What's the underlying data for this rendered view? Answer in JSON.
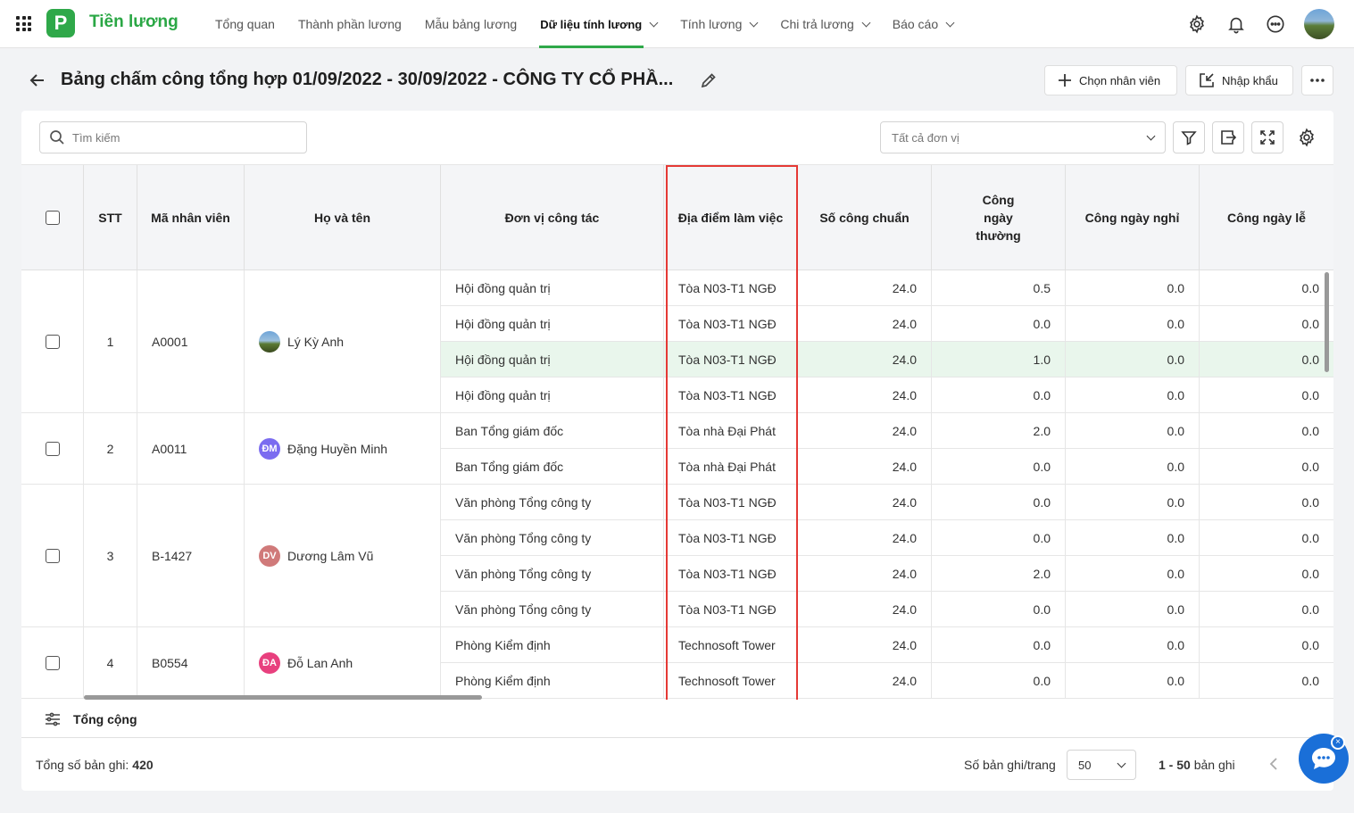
{
  "app": {
    "logo_letter": "P",
    "title": "Tiền lương",
    "accent": "#2fa849"
  },
  "nav": [
    {
      "label": "Tổng quan",
      "dropdown": false,
      "active": false
    },
    {
      "label": "Thành phần lương",
      "dropdown": false,
      "active": false
    },
    {
      "label": "Mẫu bảng lương",
      "dropdown": false,
      "active": false
    },
    {
      "label": "Dữ liệu tính lương",
      "dropdown": true,
      "active": true
    },
    {
      "label": "Tính lương",
      "dropdown": true,
      "active": false
    },
    {
      "label": "Chi trả lương",
      "dropdown": true,
      "active": false
    },
    {
      "label": "Báo cáo",
      "dropdown": true,
      "active": false
    }
  ],
  "page": {
    "title": "Bảng chấm công tổng hợp 01/09/2022 - 30/09/2022 - CÔNG TY CỔ PHẦ...",
    "choose_employee": "Chọn nhân viên",
    "import": "Nhập khẩu"
  },
  "toolbar": {
    "search_placeholder": "Tìm kiếm",
    "unit_filter": "Tất cả đơn vị"
  },
  "columns": {
    "stt": "STT",
    "code": "Mã nhân viên",
    "name": "Họ và tên",
    "unit": "Đơn vị công tác",
    "location": "Địa điểm làm việc",
    "standard": "Số công chuẩn",
    "normal_day": "Công ngày thường",
    "day_off": "Công ngày nghỉ",
    "holiday": "Công ngày lễ"
  },
  "employees": [
    {
      "stt": "1",
      "code": "A0001",
      "name": "Lý Kỳ Anh",
      "initials": "",
      "avatar_color": "photo",
      "rows": [
        {
          "unit": "Hội đồng quản trị",
          "location": "Tòa N03-T1 NGĐ",
          "standard": "24.0",
          "normal": "0.5",
          "off": "0.0",
          "holiday": "0.0"
        },
        {
          "unit": "Hội đồng quản trị",
          "location": "Tòa N03-T1 NGĐ",
          "standard": "24.0",
          "normal": "0.0",
          "off": "0.0",
          "holiday": "0.0"
        },
        {
          "unit": "Hội đồng quản trị",
          "location": "Tòa N03-T1 NGĐ",
          "standard": "24.0",
          "normal": "1.0",
          "off": "0.0",
          "holiday": "0.0"
        },
        {
          "unit": "Hội đồng quản trị",
          "location": "Tòa N03-T1 NGĐ",
          "standard": "24.0",
          "normal": "0.0",
          "off": "0.0",
          "holiday": "0.0"
        }
      ]
    },
    {
      "stt": "2",
      "code": "A0011",
      "name": "Đặng Huyền Minh",
      "initials": "ĐM",
      "avatar_color": "#7b6cf0",
      "rows": [
        {
          "unit": "Ban Tổng giám đốc",
          "location": "Tòa nhà Đại Phát",
          "standard": "24.0",
          "normal": "2.0",
          "off": "0.0",
          "holiday": "0.0"
        },
        {
          "unit": "Ban Tổng giám đốc",
          "location": "Tòa nhà Đại Phát",
          "standard": "24.0",
          "normal": "0.0",
          "off": "0.0",
          "holiday": "0.0"
        }
      ]
    },
    {
      "stt": "3",
      "code": "B-1427",
      "name": "Dương Lâm Vũ",
      "initials": "DV",
      "avatar_color": "#d07a7a",
      "rows": [
        {
          "unit": "Văn phòng Tổng công ty",
          "location": "Tòa N03-T1 NGĐ",
          "standard": "24.0",
          "normal": "0.0",
          "off": "0.0",
          "holiday": "0.0"
        },
        {
          "unit": "Văn phòng Tổng công ty",
          "location": "Tòa N03-T1 NGĐ",
          "standard": "24.0",
          "normal": "0.0",
          "off": "0.0",
          "holiday": "0.0"
        },
        {
          "unit": "Văn phòng Tổng công ty",
          "location": "Tòa N03-T1 NGĐ",
          "standard": "24.0",
          "normal": "2.0",
          "off": "0.0",
          "holiday": "0.0"
        },
        {
          "unit": "Văn phòng Tổng công ty",
          "location": "Tòa N03-T1 NGĐ",
          "standard": "24.0",
          "normal": "0.0",
          "off": "0.0",
          "holiday": "0.0"
        }
      ]
    },
    {
      "stt": "4",
      "code": "B0554",
      "name": "Đỗ Lan Anh",
      "initials": "ĐA",
      "avatar_color": "#e8407e",
      "rows": [
        {
          "unit": "Phòng Kiểm định",
          "location": "Technosoft Tower",
          "standard": "24.0",
          "normal": "0.0",
          "off": "0.0",
          "holiday": "0.0"
        },
        {
          "unit": "Phòng Kiểm định",
          "location": "Technosoft Tower",
          "standard": "24.0",
          "normal": "0.0",
          "off": "0.0",
          "holiday": "0.0"
        }
      ]
    }
  ],
  "highlighted_row": 2,
  "summary": {
    "label": "Tổng cộng"
  },
  "footer": {
    "total_label": "Tổng số bản ghi:",
    "total_value": "420",
    "per_page_label": "Số bản ghi/trang",
    "per_page_value": "50",
    "range": "1 - 50",
    "range_suffix": "bản ghi"
  }
}
